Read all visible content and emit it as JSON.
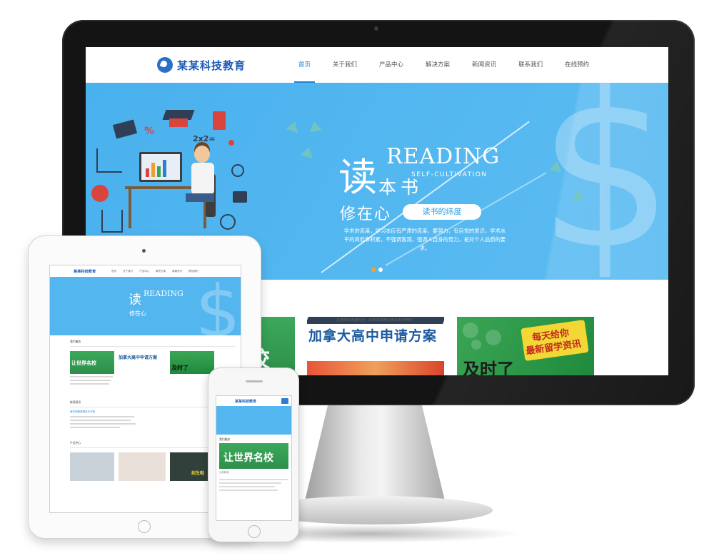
{
  "desktop": {
    "logo": "某某科技教育",
    "nav": [
      "首页",
      "关于我们",
      "产品中心",
      "解决方案",
      "新闻资讯",
      "联系我们",
      "在线预约"
    ],
    "banner": {
      "char_read": "读",
      "reading": "READING",
      "self_cultivation": "SELF-CULTIVATION",
      "char_ben": "本书",
      "xiu_zai_xin": "修在心",
      "pill": "读书的纬度",
      "desc": "学术的态度，学习本应有严肃的态度，要努力，有自觉的意识，学术水平的高低靠积累，不强调客观，强调人自身的努力，是对个人品质的要求。",
      "dollar": "$",
      "formula": "2x2=",
      "percent": "%"
    },
    "cards": {
      "card1_text": "校",
      "card2_caption": "在刚刚的青春时光，如何享受最优质的高中教育？",
      "card2_title": "加拿大高中申请方案",
      "card3_line1": "每天给你",
      "card3_line2": "最新留学资讯",
      "card3_big": "及时了"
    },
    "colors": {
      "brand": "#1d5bb8",
      "accent": "#1f83d6",
      "banner": "#53b6ef"
    }
  },
  "tablet": {
    "logo": "某某科技教育",
    "nav": [
      "首页",
      "关于我们",
      "产品中心",
      "解决方案",
      "新闻资讯",
      "联系我们"
    ],
    "banner_read": "读",
    "banner_reading": "READING",
    "banner_xin": "修在心",
    "section1": "我们服务",
    "card_a": "让世界名校",
    "card_b": "加拿大高中申请方案",
    "card_c": "及时了",
    "section2": "新闻资讯",
    "news_headline": "我们的教育理念与方案",
    "section3": "产品中心",
    "bottom_tag": "招生啦"
  },
  "phone": {
    "logo": "某某科技教育",
    "section": "我们服务",
    "card_text": "让世界名校",
    "card_sub": "为你转身"
  }
}
